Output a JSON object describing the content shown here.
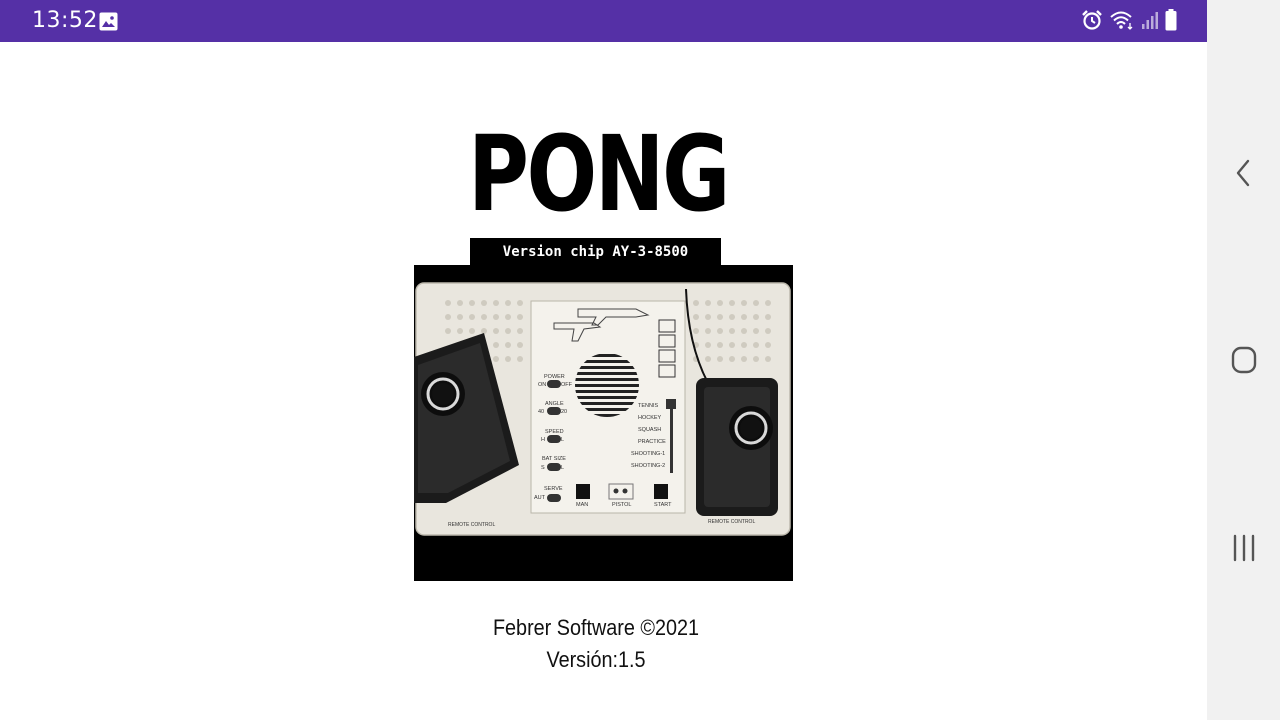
{
  "status_bar": {
    "time": "13:52",
    "background_color": "#5530a6",
    "left_icons": [
      "gallery-icon"
    ],
    "right_icons": [
      "alarm-icon",
      "wifi-icon",
      "signal-icon",
      "battery-icon"
    ]
  },
  "app": {
    "title": "PONG",
    "subtitle": "Version chip AY-3-8500",
    "image": {
      "description_icon": "pong-console-photo",
      "labels": {
        "power": "POWER",
        "on": "ON",
        "off": "OFF",
        "angle": "ANGLE",
        "angle_left": "40",
        "angle_right": "20",
        "speed": "SPEED",
        "speed_left": "H",
        "speed_right": "L",
        "bat_size": "BAT SIZE",
        "bat_left": "S",
        "bat_right": "L",
        "serve": "SERVE",
        "serve_left": "AUT",
        "man": "MAN",
        "pistol": "PISTOL",
        "start": "START",
        "games": [
          "TENNIS",
          "HOCKEY",
          "SQUASH",
          "PRACTICE",
          "SHOOTING-1",
          "SHOOTING-2"
        ],
        "remote_left": "REMOTE CONTROL",
        "remote_right": "REMOTE CONTROL"
      }
    },
    "footer": {
      "copyright": "Febrer Software ©2021",
      "version": "Versión:1.5"
    }
  },
  "nav_bar": {
    "buttons": [
      "back-icon",
      "home-icon",
      "recents-icon"
    ]
  }
}
